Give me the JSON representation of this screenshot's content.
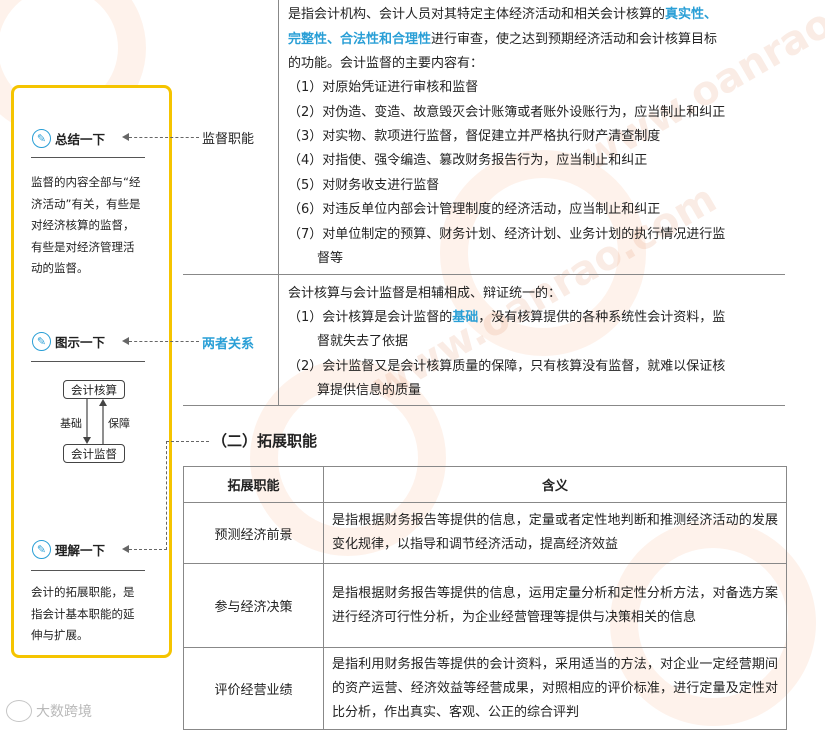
{
  "sidebar": {
    "sections": [
      {
        "title": "总结一下",
        "body": "监督的内容全部与“经济活动”有关，有些是对经济核算的监督，有些是对经济管理活动的监督。"
      },
      {
        "title": "图示一下"
      },
      {
        "title": "理解一下",
        "body": "会计的拓展职能，是指会计基本职能的延伸与扩展。"
      }
    ],
    "diagram": {
      "top_box": "会计核算",
      "bottom_box": "会计监督",
      "left_label": "基础",
      "right_label": "保障"
    }
  },
  "supervision": {
    "label": "监督职能",
    "intro_prefix": "是指会计机构、会计人员对其特定主体经济活动和相关会计核算的",
    "intro_highlight_1": "真实性、",
    "intro_highlight_2": "完整性、合法性和合理性",
    "intro_suffix": "进行审查，使之达到预期经济活动和会计核算目标",
    "intro_line3": "的功能。会计监督的主要内容有：",
    "items": [
      "（1）对原始凭证进行审核和监督",
      "（2）对伪造、变造、故意毁灭会计账簿或者账外设账行为，应当制止和纠正",
      "（3）对实物、款项进行监督，督促建立并严格执行财产清查制度",
      "（4）对指使、强令编造、篡改财务报告行为，应当制止和纠正",
      "（5）对财务收支进行监督",
      "（6）对违反单位内部会计管理制度的经济活动，应当制止和纠正",
      "（7）对单位制定的预算、财务计划、经济计划、业务计划的执行情况进行监",
      "督等"
    ]
  },
  "relation": {
    "label": "两者关系",
    "intro": "会计核算与会计监督是相辅相成、辩证统一的：",
    "item1_prefix": "（1）会计核算是会计监督的",
    "item1_highlight": "基础",
    "item1_suffix": "，没有核算提供的各种系统性会计资料，监",
    "item1_line2": "督就失去了依据",
    "item2_line1": "（2）会计监督又是会计核算质量的保障，只有核算没有监督，就难以保证核",
    "item2_line2": "算提供信息的质量"
  },
  "extended": {
    "heading": "（二）拓展职能",
    "headers": [
      "拓展职能",
      "含义"
    ],
    "rows": [
      {
        "name": "预测经济前景",
        "meaning": "是指根据财务报告等提供的信息，定量或者定性地判断和推测经济活动的发展变化规律，以指导和调节经济活动，提高经济效益"
      },
      {
        "name": "参与经济决策",
        "meaning": "是指根据财务报告等提供的信息，运用定量分析和定性分析方法，对备选方案进行经济可行性分析，为企业经营管理等提供与决策相关的信息"
      },
      {
        "name": "评价经营业绩",
        "meaning": "是指利用财务报告等提供的会计资料，采用适当的方法，对企业一定经营期间的资产运营、经济效益等经营成果，对照相应的评价标准，进行定量及定性对比分析，作出真实、客观、公正的综合评判"
      }
    ]
  },
  "brand": "大数跨境",
  "colors": {
    "accent_blue": "#2a9fd6",
    "frame_yellow": "#f5c400"
  }
}
